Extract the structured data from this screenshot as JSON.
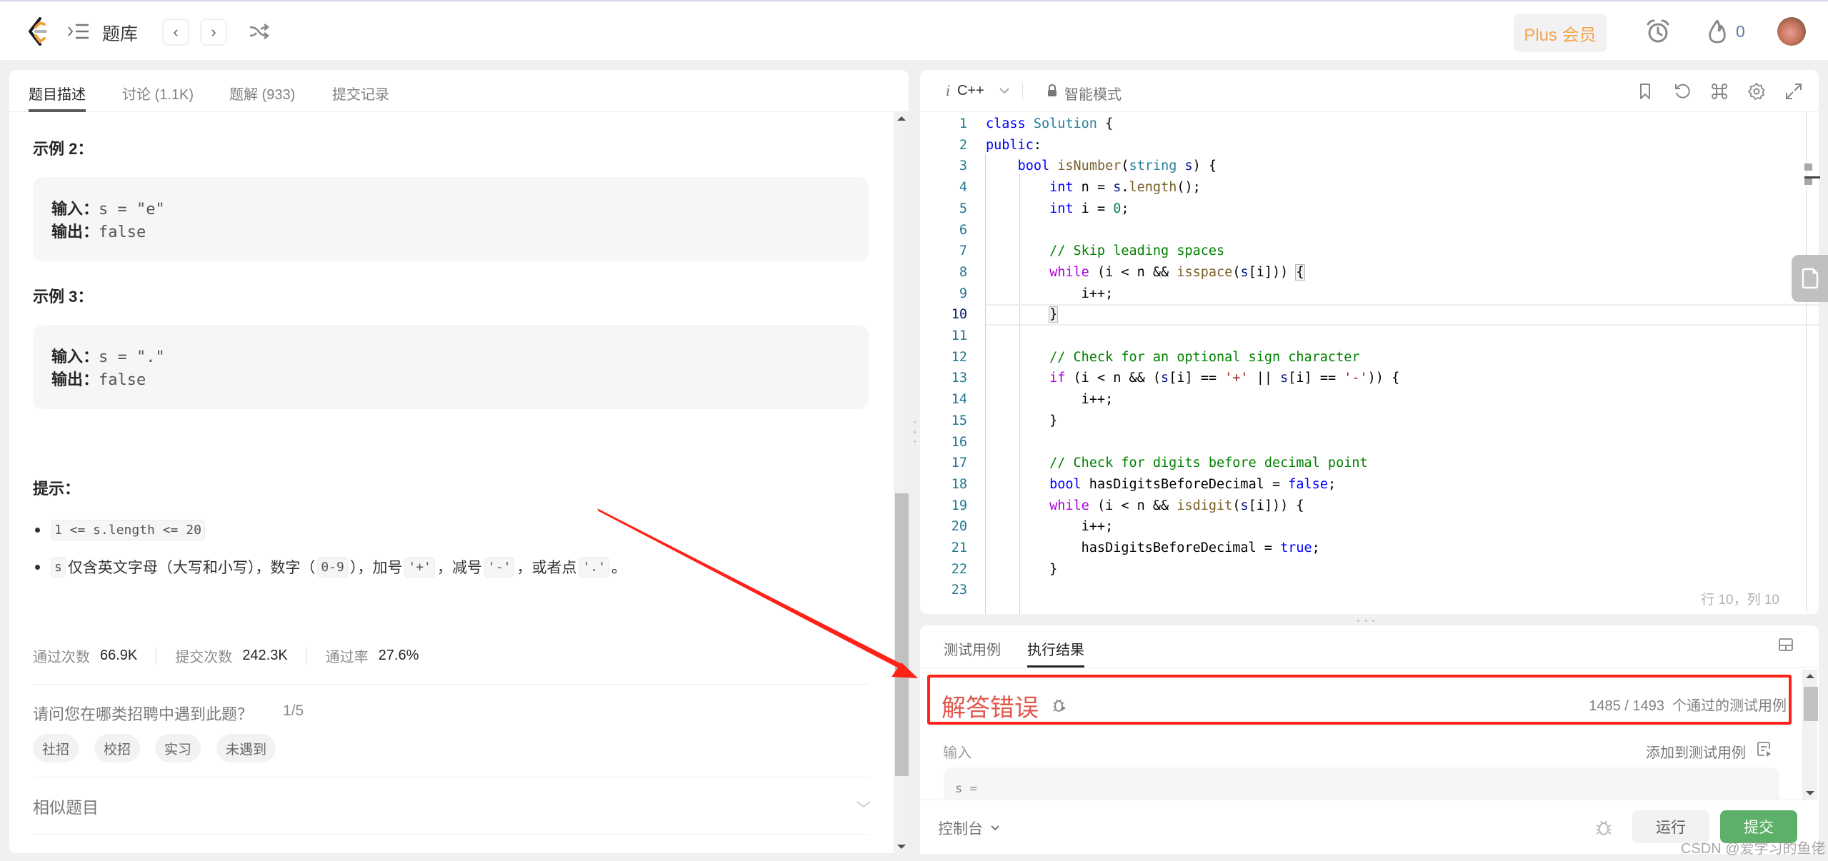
{
  "nav": {
    "title": "题库",
    "prev_label": "‹",
    "next_label": "›",
    "plus_label": "Plus 会员",
    "streak_count": "0"
  },
  "left": {
    "tabs": [
      {
        "label": "题目描述",
        "active": true
      },
      {
        "label": "讨论 (1.1K)",
        "active": false
      },
      {
        "label": "题解 (933)",
        "active": false
      },
      {
        "label": "提交记录",
        "active": false
      }
    ],
    "examples": [
      {
        "title": "示例 2：",
        "input_label": "输入：",
        "input_value": "s = \"e\"",
        "output_label": "输出：",
        "output_value": "false"
      },
      {
        "title": "示例 3：",
        "input_label": "输入：",
        "input_value": "s = \".\"",
        "output_label": "输出：",
        "output_value": "false"
      }
    ],
    "hint_title": "提示：",
    "hints": {
      "h1_code": "1 <= s.length <= 20",
      "h2_code_s": "s",
      "h2_text1": "仅含英文字母（大写和小写），数字（",
      "h2_code_digits": "0-9",
      "h2_text2": "），加号",
      "h2_code_plus": "'+'",
      "h2_text3": "，减号",
      "h2_code_minus": "'-'",
      "h2_text4": "，或者点",
      "h2_code_dot": "'.'",
      "h2_text5": "。"
    },
    "stats": {
      "accepted_label": "通过次数",
      "accepted_value": "66.9K",
      "submitted_label": "提交次数",
      "submitted_value": "242.3K",
      "rate_label": "通过率",
      "rate_value": "27.6%"
    },
    "survey": {
      "question": "请问您在哪类招聘中遇到此题？",
      "count": "1/5",
      "chips": [
        "社招",
        "校招",
        "实习",
        "未遇到"
      ]
    },
    "similar_label": "相似题目",
    "scroll_position": 0.62
  },
  "editor": {
    "lang_icon": "i",
    "language": "C++",
    "mode": "智能模式",
    "current_line": 10,
    "cursor_position": "行 10，列 10",
    "lines": [
      {
        "n": "1",
        "html": "<span class='kw'>class</span> <span class='ty'>Solution</span> {"
      },
      {
        "n": "2",
        "html": "<span class='kw'>public</span>:"
      },
      {
        "n": "3",
        "html": "    <span class='kw'>bool</span> <span class='fn'>isNumber</span>(<span class='ty'>string</span> <span class='var'>s</span>) {"
      },
      {
        "n": "4",
        "html": "        <span class='kw'>int</span> n = <span class='var'>s</span>.<span class='fn'>length</span>();"
      },
      {
        "n": "5",
        "html": "        <span class='kw'>int</span> i = <span class='num'>0</span>;"
      },
      {
        "n": "6",
        "html": ""
      },
      {
        "n": "7",
        "html": "        <span class='cm'>// Skip leading spaces</span>"
      },
      {
        "n": "8",
        "html": "        <span class='ctl'>while</span> (i &lt; n &amp;&amp; <span class='fn'>isspace</span>(<span class='var'>s</span>[i])) <span class='brk'>{</span>"
      },
      {
        "n": "9",
        "html": "            i++;"
      },
      {
        "n": "10",
        "html": "        <span class='brk'>}</span>"
      },
      {
        "n": "11",
        "html": ""
      },
      {
        "n": "12",
        "html": "        <span class='cm'>// Check for an optional sign character</span>"
      },
      {
        "n": "13",
        "html": "        <span class='ctl'>if</span> (i &lt; n &amp;&amp; (<span class='var'>s</span>[i] == <span class='str'>'+'</span> || <span class='var'>s</span>[i] == <span class='str'>'-'</span>)) {"
      },
      {
        "n": "14",
        "html": "            i++;"
      },
      {
        "n": "15",
        "html": "        }"
      },
      {
        "n": "16",
        "html": ""
      },
      {
        "n": "17",
        "html": "        <span class='cm'>// Check for digits before decimal point</span>"
      },
      {
        "n": "18",
        "html": "        <span class='kw'>bool</span> hasDigitsBeforeDecimal = <span class='kw'>false</span>;"
      },
      {
        "n": "19",
        "html": "        <span class='ctl'>while</span> (i &lt; n &amp;&amp; <span class='fn'>isdigit</span>(<span class='var'>s</span>[i])) {"
      },
      {
        "n": "20",
        "html": "            i++;"
      },
      {
        "n": "21",
        "html": "            hasDigitsBeforeDecimal = <span class='kw'>true</span>;"
      },
      {
        "n": "22",
        "html": "        }"
      },
      {
        "n": "23",
        "html": ""
      }
    ]
  },
  "result": {
    "tabs": [
      {
        "label": "测试用例",
        "active": false
      },
      {
        "label": "执行结果",
        "active": true
      }
    ],
    "verdict": "解答错误",
    "passed": "1485 / 1493",
    "passed_suffix": "个通过的测试用例",
    "input_label": "输入",
    "add_to_testcase": "添加到测试用例",
    "input_value": "s =",
    "console_label": "控制台",
    "run_label": "运行",
    "submit_label": "提交"
  },
  "colors": {
    "accent_orange": "#f5a54a",
    "verdict_red": "#e2574c",
    "annotation_red": "#ff2218",
    "submit_green": "#5cb068"
  },
  "watermark": "CSDN @爱学习的鱼佬"
}
